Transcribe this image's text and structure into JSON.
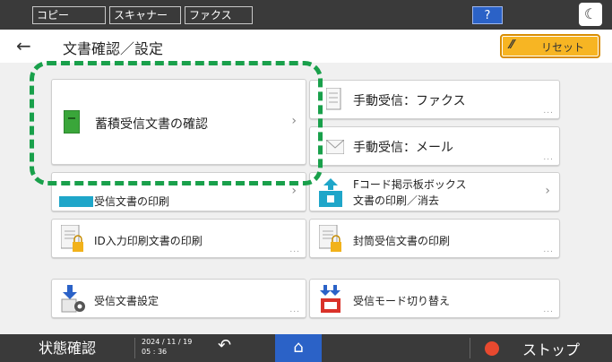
{
  "top_tabs": [
    "コピー",
    "スキャナー",
    "ファクス"
  ],
  "help_label": "?",
  "header": {
    "back": "←",
    "title": "文書確認／設定",
    "reset_label": "リセット"
  },
  "cards": {
    "stored_docs": "蓄積受信文書の確認",
    "manual_fax": "手動受信：ファクス",
    "manual_mail": "手動受信：メール",
    "print_received": "受信文書の印刷",
    "fcode_line1": "Fコード掲示板ボックス",
    "fcode_line2": "文書の印刷／消去",
    "id_print": "ID入力印刷文書の印刷",
    "envelope_print": "封筒受信文書の印刷",
    "received_settings": "受信文書設定",
    "receive_mode": "受信モード切り替え",
    "more": "..."
  },
  "bottom": {
    "status": "状態確認",
    "date": "2024 / 11 / 19",
    "time": "05 : 36",
    "stop": "ストップ"
  },
  "colors": {
    "accent_blue": "#2b62c7",
    "highlight_green": "#19a04b",
    "reset_orange": "#f7b523"
  }
}
